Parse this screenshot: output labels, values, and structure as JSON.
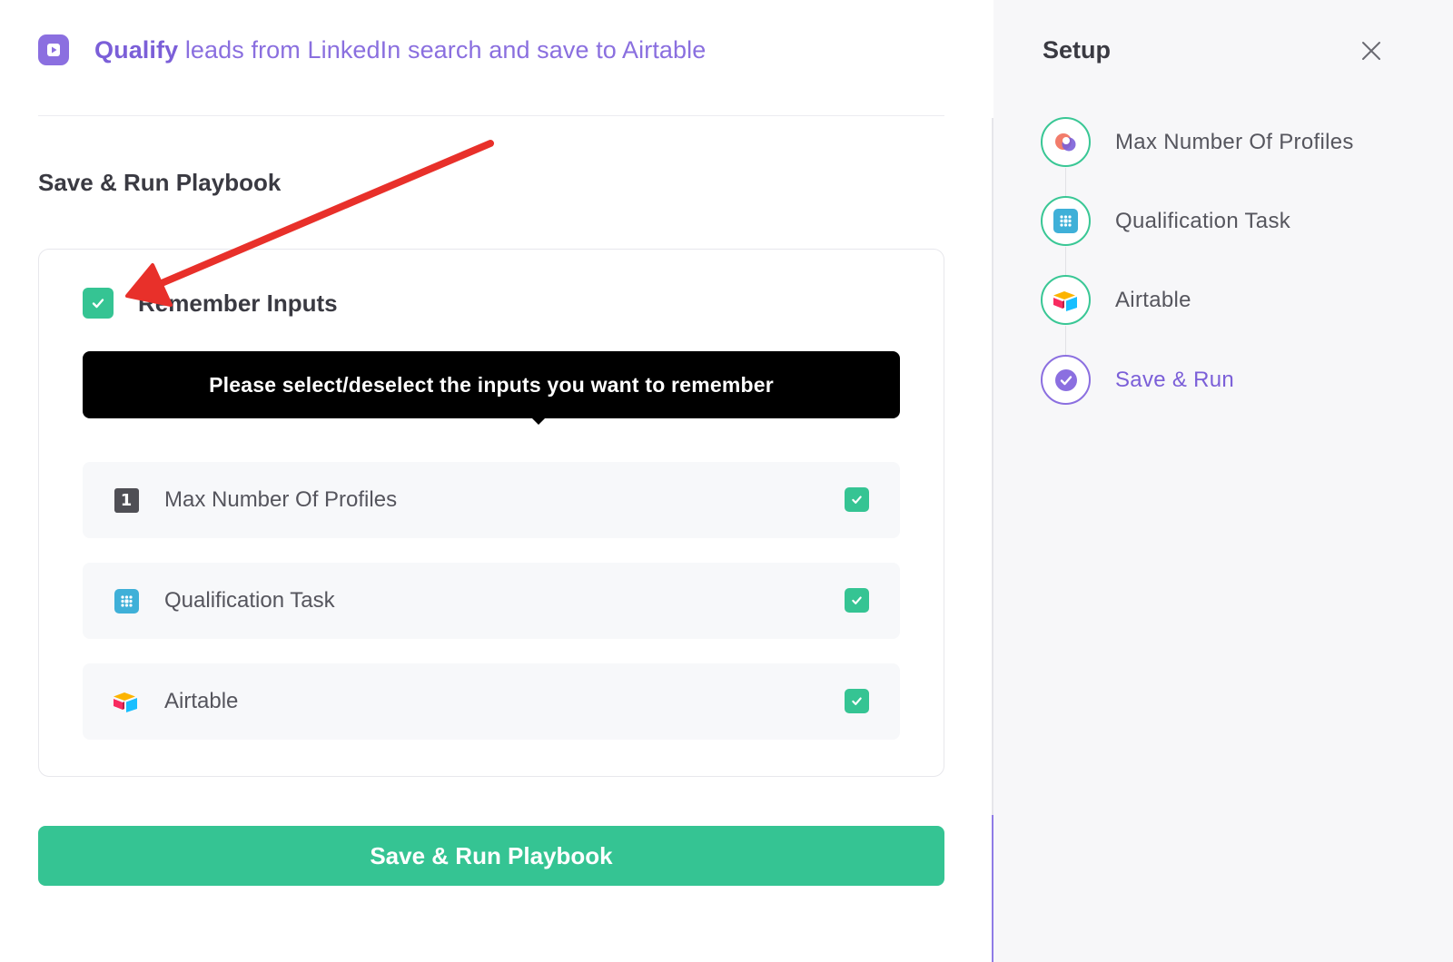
{
  "header": {
    "title_strong": "Qualify",
    "title_rest": " leads from LinkedIn search and save to Airtable",
    "icon": "play-icon"
  },
  "main": {
    "section_title": "Save & Run Playbook",
    "remember": {
      "label": "Remember Inputs",
      "checked": true
    },
    "tooltip": "Please select/deselect the inputs you want to remember",
    "inputs": [
      {
        "label": "Max Number Of Profiles",
        "icon": "number-1-icon",
        "checked": true
      },
      {
        "label": "Qualification Task",
        "icon": "grid-dots-icon",
        "checked": true
      },
      {
        "label": "Airtable",
        "icon": "airtable-logo-icon",
        "checked": true
      }
    ],
    "primary_button": "Save & Run Playbook"
  },
  "sidebar": {
    "title": "Setup",
    "close_icon": "close-icon",
    "steps": [
      {
        "label": "Max Number Of Profiles",
        "icon": "profiles-logo-icon",
        "state": "done"
      },
      {
        "label": "Qualification Task",
        "icon": "grid-dots-icon",
        "state": "done"
      },
      {
        "label": "Airtable",
        "icon": "airtable-logo-icon",
        "state": "done"
      },
      {
        "label": "Save & Run",
        "icon": "check-circle-icon",
        "state": "active"
      }
    ]
  },
  "colors": {
    "accent_purple": "#7b5fd8",
    "accent_green": "#35c493",
    "tooltip_bg": "#000000",
    "annotation_red": "#e8302a"
  }
}
